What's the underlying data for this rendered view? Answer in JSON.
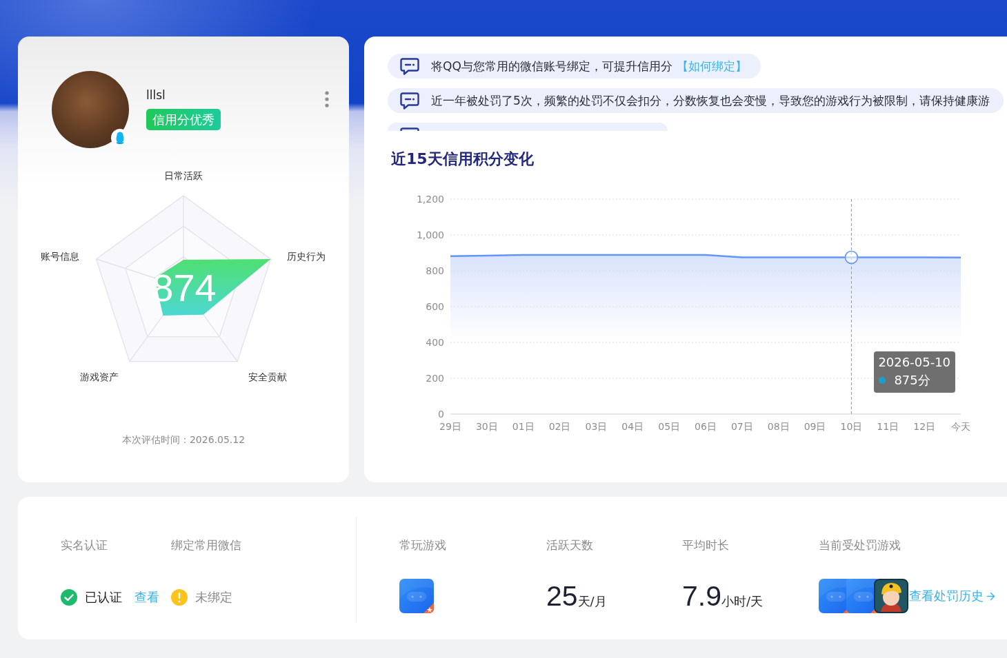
{
  "profile": {
    "name": "lllsl",
    "badge": "信用分优秀"
  },
  "radar": {
    "axes": [
      "日常活跃",
      "历史行为",
      "安全贡献",
      "游戏资产",
      "账号信息"
    ],
    "score": "874",
    "evaluation_time": "本次评估时间：2026.05.12"
  },
  "notices": [
    {
      "kind": "text",
      "text": "将QQ与您常用的微信账号绑定，可提升信用分",
      "link": "【如何绑定】"
    },
    {
      "kind": "text",
      "text": "近一年被处罚了5次，频繁的处罚不仅会扣分，分数恢复也会变慢，导致您的游戏行为被限制，请保持健康游"
    },
    {
      "kind": "clipped"
    }
  ],
  "chart": {
    "title": "近15天信用积分变化",
    "chart_data": {
      "type": "area",
      "categories": [
        "29日",
        "30日",
        "01日",
        "02日",
        "03日",
        "04日",
        "05日",
        "06日",
        "07日",
        "08日",
        "09日",
        "10日",
        "11日",
        "12日",
        "今天"
      ],
      "series": [
        {
          "color": "#6395f9",
          "values": [
            882,
            885,
            888,
            888,
            888,
            888,
            888,
            888,
            875,
            875,
            875,
            875,
            875,
            875,
            874
          ]
        }
      ],
      "ylim": [
        0,
        1200
      ],
      "yticks": [
        {
          "value": 0,
          "label": "0"
        },
        {
          "value": 200,
          "label": "200"
        },
        {
          "value": 400,
          "label": "400"
        },
        {
          "value": 600,
          "label": "600"
        },
        {
          "value": 800,
          "label": "800"
        },
        {
          "value": 1000,
          "label": "1,000"
        },
        {
          "value": 1200,
          "label": "1,200"
        }
      ],
      "grid": true,
      "ref_lines": [
        {
          "axis": "x",
          "value": "10日"
        }
      ],
      "annotations": [
        "2026-05-10",
        "875分"
      ]
    }
  },
  "verification": [
    {
      "label": "实名认证",
      "status": "已认证",
      "verified": true,
      "link": "查看"
    },
    {
      "label": "绑定常用微信",
      "status": "未绑定",
      "verified": false
    }
  ],
  "stats": [
    {
      "kind": "games",
      "label": "常玩游戏",
      "games": [
        {
          "kind": "generic"
        }
      ]
    },
    {
      "kind": "value",
      "label": "活跃天数",
      "value": "25",
      "unit": "天/月"
    },
    {
      "kind": "value",
      "label": "平均时长",
      "value": "7.9",
      "unit": "小时/天"
    },
    {
      "kind": "games",
      "label": "当前受处罚游戏",
      "games": [
        {
          "kind": "generic"
        },
        {
          "kind": "generic"
        },
        {
          "kind": "character"
        }
      ],
      "link": "查看处罚历史"
    }
  ]
}
